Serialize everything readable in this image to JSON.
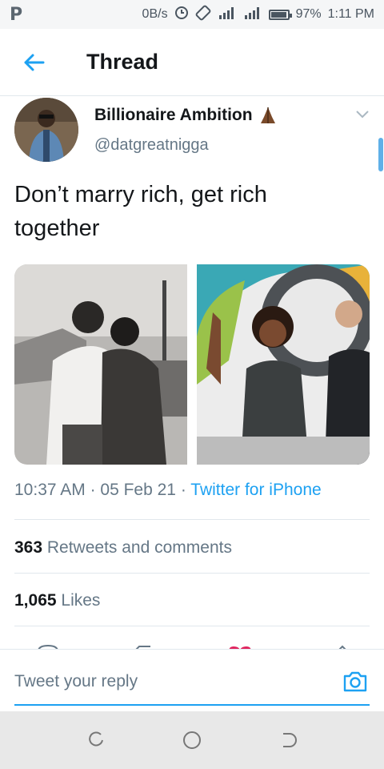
{
  "status_bar": {
    "left_icon": "P",
    "speed": "0B/s",
    "battery_pct": "97%",
    "battery_level": 0.97,
    "time": "1:11 PM",
    "icons": [
      "data-saver-icon",
      "rotate-icon",
      "signal-4g-icon",
      "signal-icon",
      "battery-icon"
    ]
  },
  "header": {
    "title": "Thread"
  },
  "tweet": {
    "author_name": "Billionaire Ambition",
    "author_emoji": "🙏🏾",
    "handle": "@datgreatnigga",
    "text_line1": "Don’t marry rich, get rich",
    "text_line2": "together",
    "time": "10:37 AM",
    "sep1": " · ",
    "date": "05 Feb 21",
    "sep2": " · ",
    "source": "Twitter for iPhone",
    "retweets_count": "363",
    "retweets_label": " Retweets and comments",
    "likes_count": "1,065",
    "likes_label": " Likes"
  },
  "reply": {
    "placeholder": "Tweet your reply"
  },
  "colors": {
    "accent": "#1da1f2",
    "text": "#14171a",
    "secondary": "#657786",
    "divider": "#e1e8ed"
  }
}
